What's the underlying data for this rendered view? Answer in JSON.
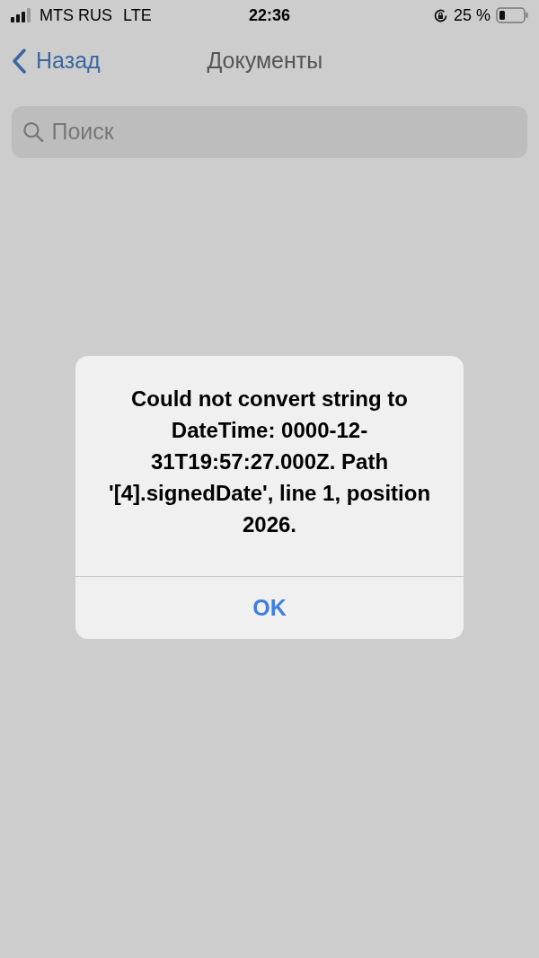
{
  "status_bar": {
    "carrier": "MTS RUS",
    "network": "LTE",
    "time": "22:36",
    "battery": "25 %"
  },
  "nav": {
    "back": "Назад",
    "title": "Документы"
  },
  "search": {
    "placeholder": "Поиск"
  },
  "alert": {
    "message": "Could not convert string to DateTime: 0000-12-31T19:57:27.000Z. Path '[4].signedDate', line 1, position 2026.",
    "buttons": [
      "OK"
    ]
  }
}
